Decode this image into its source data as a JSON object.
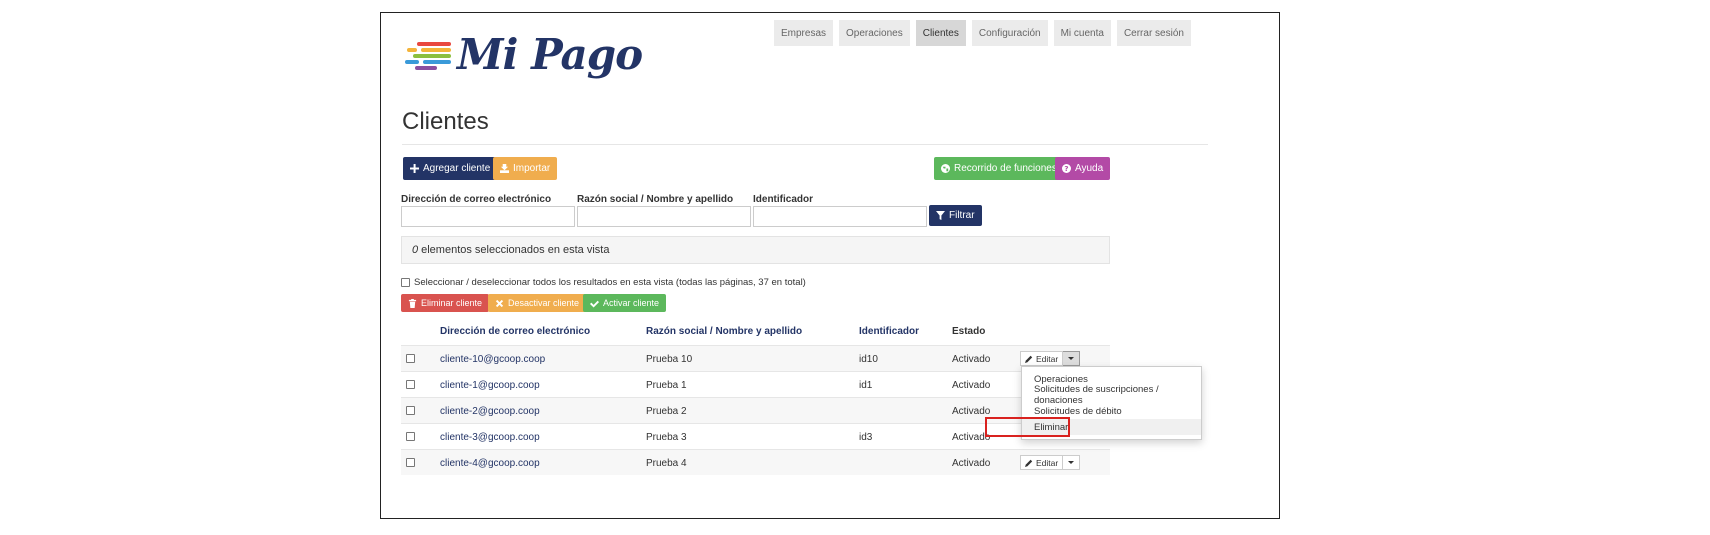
{
  "brand": {
    "name": "Mi Pago",
    "bar_colors": [
      "#e9483f",
      "#f4b43a",
      "#8cbf3f",
      "#3a9ad9",
      "#8a4fa0"
    ]
  },
  "nav": {
    "items": [
      {
        "label": "Empresas"
      },
      {
        "label": "Operaciones"
      },
      {
        "label": "Clientes",
        "active": true
      },
      {
        "label": "Configuración"
      },
      {
        "label": "Mi cuenta"
      },
      {
        "label": "Cerrar sesión"
      }
    ]
  },
  "page": {
    "title": "Clientes"
  },
  "toolbar": {
    "add": "Agregar cliente",
    "import": "Importar",
    "tour": "Recorrido de funciones",
    "help": "Ayuda"
  },
  "filters": {
    "email_label": "Dirección de correo electrónico",
    "name_label": "Razón social / Nombre y apellido",
    "id_label": "Identificador",
    "email_value": "",
    "name_value": "",
    "id_value": "",
    "button": "Filtrar"
  },
  "selection": {
    "count": "0",
    "text": "elementos seleccionados en esta vista",
    "select_all": "Seleccionar / deseleccionar todos los resultados en esta vista (todas las páginas, 37 en total)"
  },
  "bulk": {
    "delete": "Eliminar cliente",
    "deactivate": "Desactivar cliente",
    "activate": "Activar cliente"
  },
  "table": {
    "headers": {
      "email": "Dirección de correo electrónico",
      "name": "Razón social / Nombre y apellido",
      "id": "Identificador",
      "status": "Estado"
    },
    "edit_label": "Editar",
    "rows": [
      {
        "email": "cliente-10@gcoop.coop",
        "name": "Prueba 10",
        "id": "id10",
        "status": "Activado"
      },
      {
        "email": "cliente-1@gcoop.coop",
        "name": "Prueba 1",
        "id": "id1",
        "status": "Activado"
      },
      {
        "email": "cliente-2@gcoop.coop",
        "name": "Prueba 2",
        "id": "",
        "status": "Activado"
      },
      {
        "email": "cliente-3@gcoop.coop",
        "name": "Prueba 3",
        "id": "id3",
        "status": "Activado"
      },
      {
        "email": "cliente-4@gcoop.coop",
        "name": "Prueba 4",
        "id": "",
        "status": "Activado"
      }
    ]
  },
  "dropdown": {
    "items": [
      "Operaciones",
      "Solicitudes de suscripciones / donaciones",
      "Solicitudes de débito",
      "Eliminar"
    ]
  },
  "colors": {
    "navy": "#233466",
    "orange": "#f0ad4e",
    "green": "#5cb85c",
    "purple": "#b34aa6",
    "red": "#d9534f",
    "highlight": "#d9221f"
  }
}
